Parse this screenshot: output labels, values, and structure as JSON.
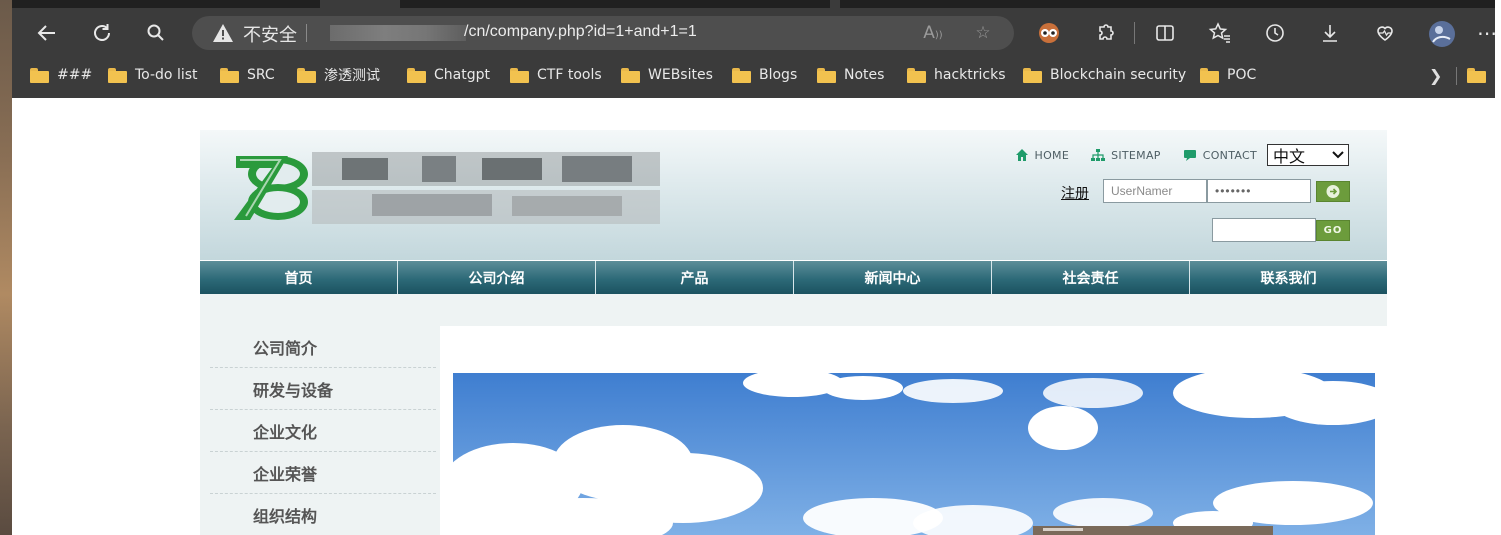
{
  "browser": {
    "nav_icons": {
      "back": "back-arrow-icon",
      "refresh": "refresh-icon",
      "search": "search-icon"
    },
    "address": {
      "security_label": "不安全",
      "url_visible": "/cn/company.php?id=1+and+1=1"
    },
    "toolbar_icons": [
      "read-aloud-icon",
      "favorite-star-icon",
      "extension-owl-icon",
      "extensions-icon",
      "split-screen-icon",
      "favorites-icon",
      "history-icon",
      "download-icon",
      "heart-health-icon",
      "profile-avatar-icon",
      "more-icon"
    ],
    "bookmarks": [
      {
        "label": "###"
      },
      {
        "label": "To-do list"
      },
      {
        "label": "SRC"
      },
      {
        "label": "渗透测试"
      },
      {
        "label": "Chatgpt"
      },
      {
        "label": "CTF tools"
      },
      {
        "label": "WEBsites"
      },
      {
        "label": "Blogs"
      },
      {
        "label": "Notes"
      },
      {
        "label": "hacktricks"
      },
      {
        "label": "Blockchain security"
      },
      {
        "label": "POC"
      }
    ]
  },
  "site": {
    "topnav": {
      "home": "HOME",
      "sitemap": "SITEMAP",
      "contact": "CONTACT",
      "language": "中文"
    },
    "login": {
      "register_label": "注册",
      "username_placeholder": "UserNamer",
      "password_mask": "•••••••",
      "go_label": "GO"
    },
    "mainnav": [
      "首页",
      "公司介绍",
      "产品",
      "新闻中心",
      "社会责任",
      "联系我们"
    ],
    "sidebar": [
      "公司简介",
      "研发与设备",
      "企业文化",
      "企业荣誉",
      "组织结构"
    ],
    "colors": {
      "nav_dark": "#1b5260",
      "logo_green": "#2a9a3c",
      "button_green": "#6c9c3c"
    }
  }
}
